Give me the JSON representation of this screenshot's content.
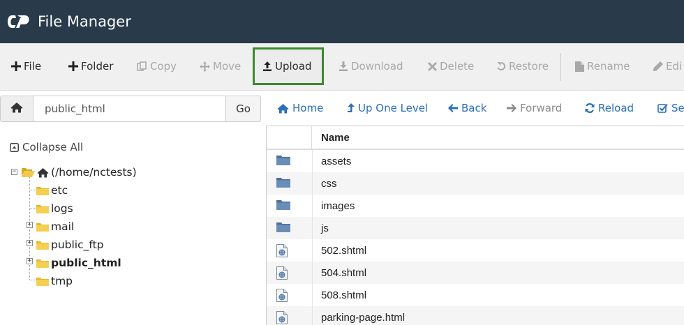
{
  "app": {
    "title": "File Manager",
    "logo": "cpanel-logo"
  },
  "toolbar": {
    "file": "File",
    "folder": "Folder",
    "copy": "Copy",
    "move": "Move",
    "upload": "Upload",
    "download": "Download",
    "delete": "Delete",
    "restore": "Restore",
    "rename": "Rename",
    "edit": "Edi"
  },
  "path": {
    "value": "public_html",
    "go": "Go"
  },
  "nav": {
    "home": "Home",
    "up": "Up One Level",
    "back": "Back",
    "forward": "Forward",
    "reload": "Reload",
    "select": "Sel"
  },
  "tree": {
    "collapse_all": "Collapse All",
    "root": "(/home/nctests)",
    "items": [
      "etc",
      "logs",
      "mail",
      "public_ftp",
      "public_html",
      "tmp"
    ],
    "selected": "public_html"
  },
  "table": {
    "header_name": "Name",
    "rows": [
      {
        "name": "assets",
        "type": "folder"
      },
      {
        "name": "css",
        "type": "folder"
      },
      {
        "name": "images",
        "type": "folder"
      },
      {
        "name": "js",
        "type": "folder"
      },
      {
        "name": "502.shtml",
        "type": "web-file"
      },
      {
        "name": "504.shtml",
        "type": "web-file"
      },
      {
        "name": "508.shtml",
        "type": "web-file"
      },
      {
        "name": "parking-page.html",
        "type": "web-file"
      }
    ]
  },
  "colors": {
    "topbar": "#293a4a",
    "link": "#2a6ebb",
    "upload_highlight": "#3c8a2e",
    "folder_yellow": "#e8b923",
    "folder_blue": "#5b7fa8"
  }
}
